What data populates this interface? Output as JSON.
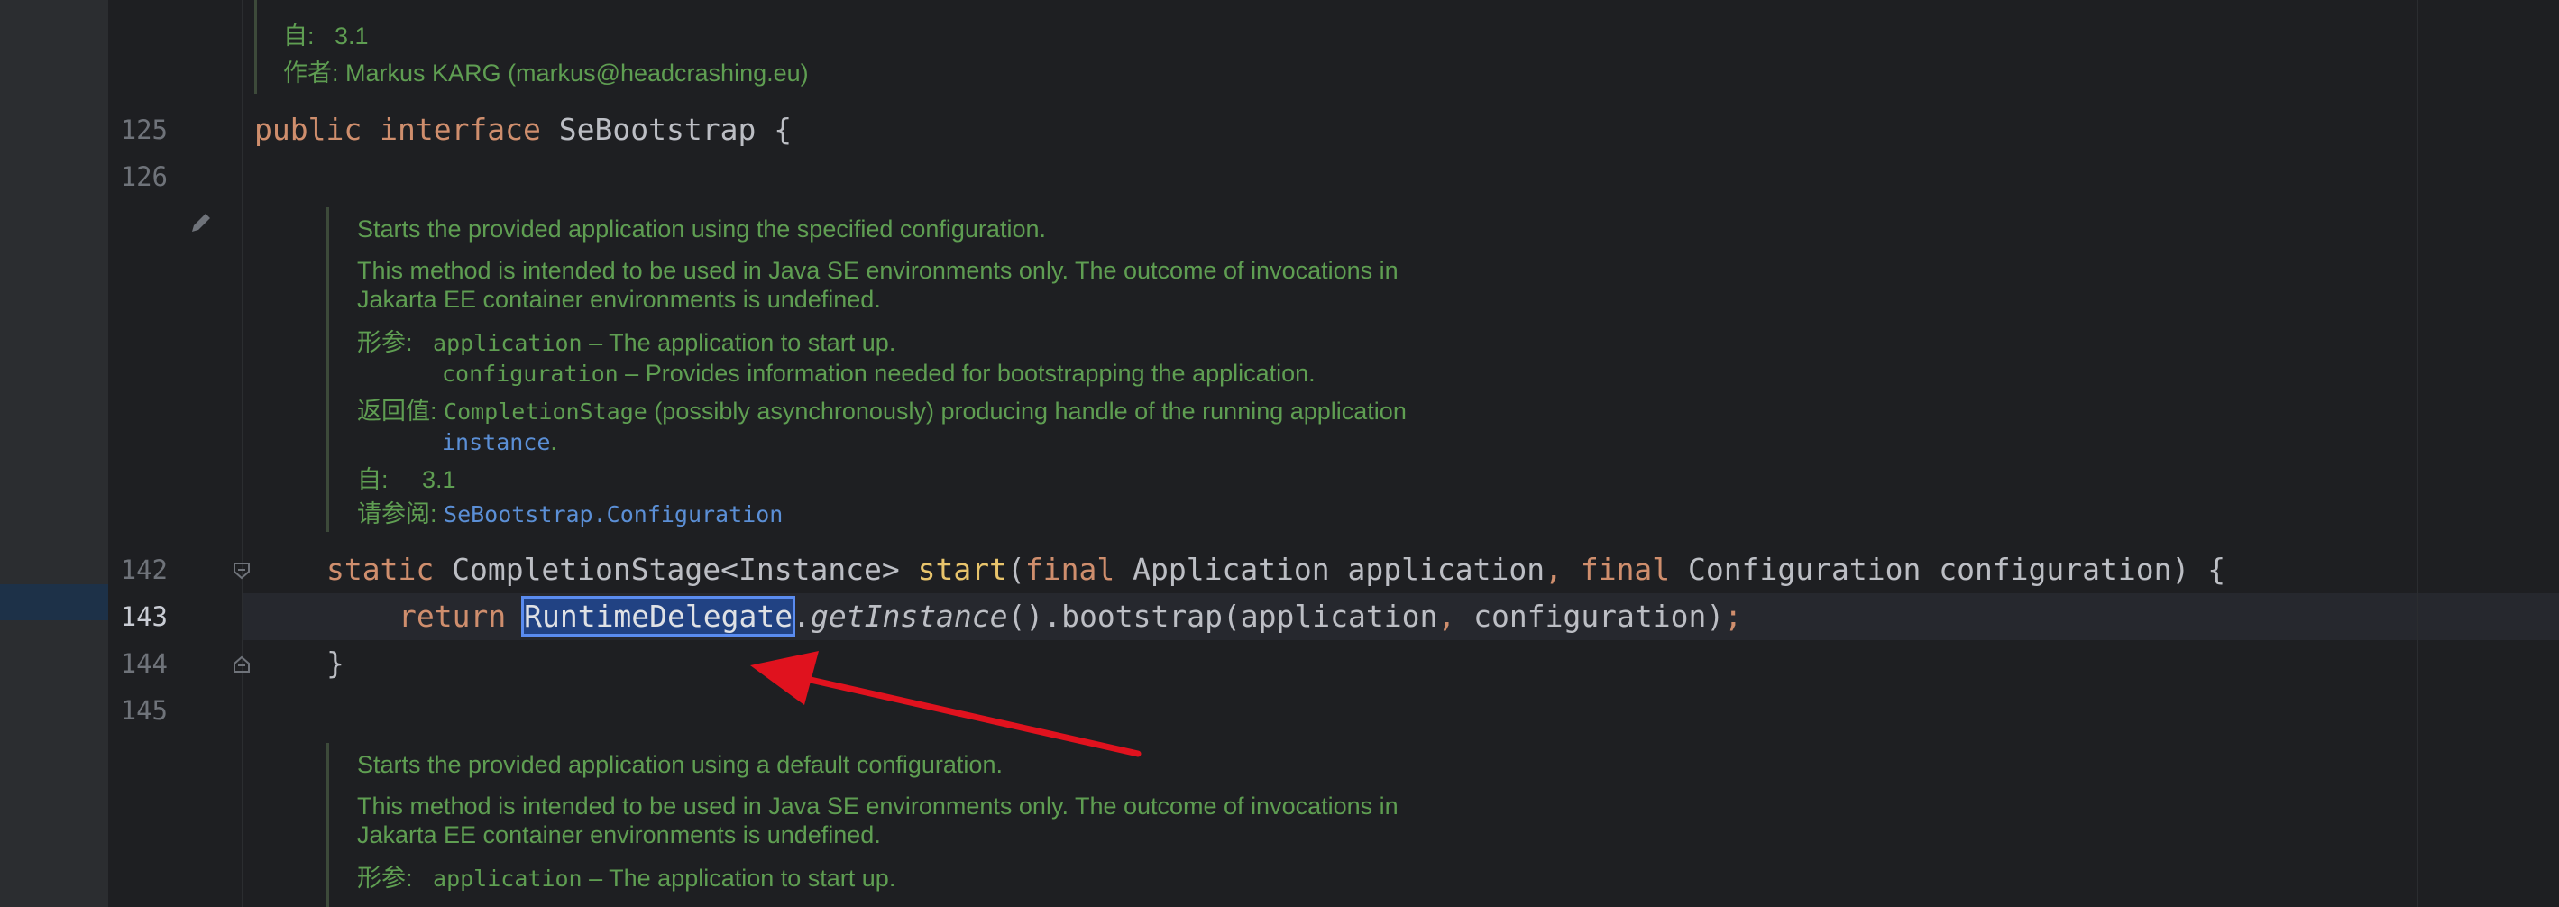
{
  "lines": {
    "l125": "125",
    "l126": "126",
    "l142": "142",
    "l143": "143",
    "l144": "144",
    "l145": "145"
  },
  "doc_top": {
    "since_label": "自:",
    "since_value": "3.1",
    "author_label": "作者:",
    "author_value": "Markus KARG (markus@headcrashing.eu)"
  },
  "code": {
    "public_kw": "public",
    "interface_kw": "interface",
    "interface_name": "SeBootstrap",
    "open_brace": "{",
    "static_kw": "static",
    "return_type": "CompletionStage<Instance>",
    "method_name": "start",
    "paren_open": "(",
    "final1": "final",
    "param1_type": "Application",
    "param1_name": "application",
    "comma1": ",",
    "final2": "final",
    "param2_type": "Configuration",
    "param2_name": "configuration",
    "sig_end": ") {",
    "return_kw": "return",
    "delegate_class": "RuntimeDelegate",
    "dot1": ".",
    "get_instance": "getInstance",
    "call_mid": "().bootstrap(application",
    "comma2": ",",
    "call_end": "configuration)",
    "semicolon": ";",
    "close_brace": "}"
  },
  "doc_start": {
    "summary": "Starts the provided application using the specified configuration.",
    "desc_line1": "This method is intended to be used in Java SE environments only. The outcome of invocations in",
    "desc_line2": "Jakarta EE container environments is undefined.",
    "params_label": "形参:",
    "param1_name": "application",
    "param1_desc": " – The application to start up.",
    "param2_name": "configuration",
    "param2_desc": " – Provides information needed for bootstrapping the application.",
    "returns_label": "返回值:",
    "returns_code": "CompletionStage",
    "returns_desc": " (possibly asynchronously) producing handle of the running application",
    "returns_link": "instance",
    "returns_end": ".",
    "since_label": "自:",
    "since_value": "3.1",
    "see_label": "请参阅:",
    "see_link": "SeBootstrap.Configuration"
  },
  "doc_next": {
    "summary": "Starts the provided application using a default configuration.",
    "desc_line1": "This method is intended to be used in Java SE environments only. The outcome of invocations in",
    "desc_line2": "Jakarta EE container environments is undefined.",
    "params_label": "形参:",
    "param1_name": "application",
    "param1_desc": " – The application to start up."
  },
  "colors": {
    "background": "#1e1f22",
    "keyword": "#cf8e6d",
    "method": "#e8c46c",
    "doc_text": "#5f9e52",
    "link": "#5b8fd6",
    "arrow": "#e0121e"
  },
  "icons": [
    "pencil-icon",
    "fold-open-icon",
    "fold-close-icon",
    "annotation-arrow-icon"
  ]
}
